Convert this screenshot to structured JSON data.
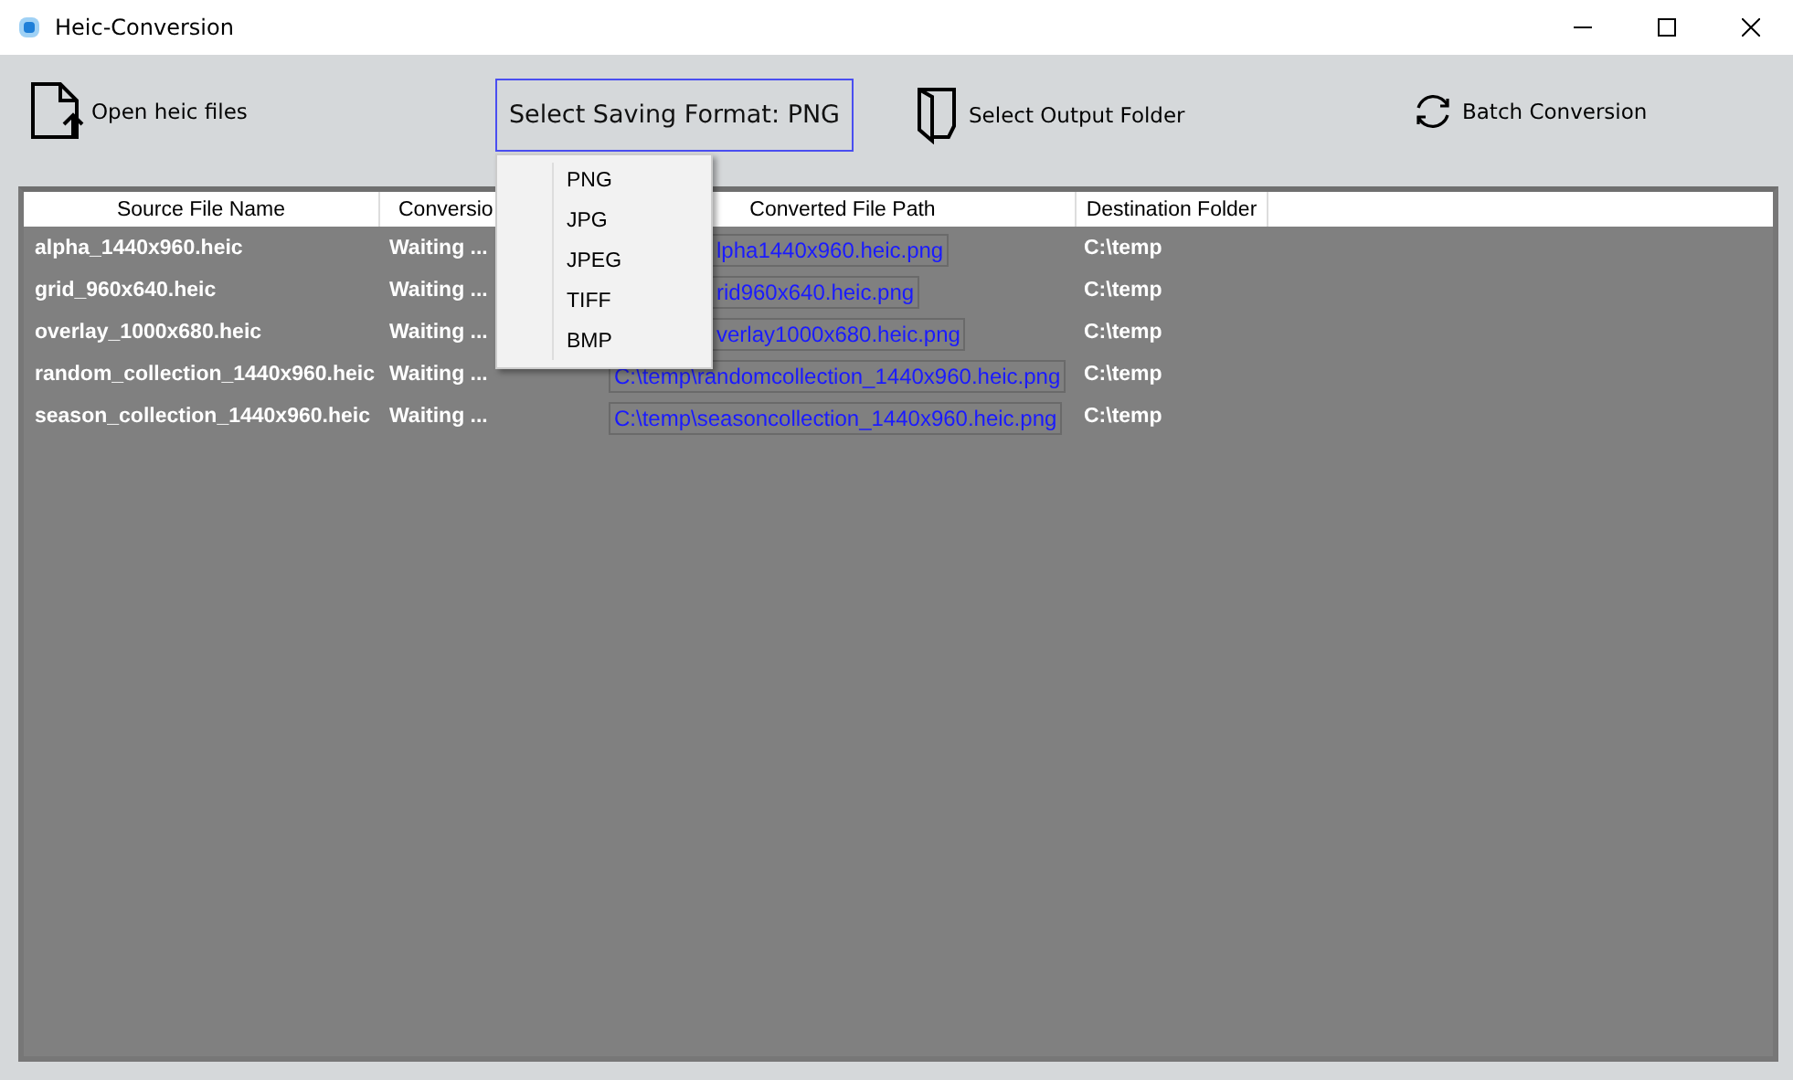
{
  "window": {
    "title": "Heic-Conversion"
  },
  "toolbar": {
    "open_button": "Open heic files",
    "format_button": "Select Saving Format: PNG",
    "output_button": "Select Output Folder",
    "batch_button": "Batch Conversion"
  },
  "format_menu": [
    {
      "label": "PNG"
    },
    {
      "label": "JPG"
    },
    {
      "label": "JPEG"
    },
    {
      "label": "TIFF"
    },
    {
      "label": "BMP"
    }
  ],
  "table": {
    "columns": [
      "Source File Name",
      "Conversio",
      "Converted File Path",
      "Destination Folder"
    ],
    "rows": [
      {
        "source": "alpha_1440x960.heic",
        "status": "Waiting ...",
        "path": "lpha1440x960.heic.png",
        "destination": "C:\\temp"
      },
      {
        "source": "grid_960x640.heic",
        "status": "Waiting ...",
        "path": "rid960x640.heic.png",
        "destination": "C:\\temp"
      },
      {
        "source": "overlay_1000x680.heic",
        "status": "Waiting ...",
        "path": "verlay1000x680.heic.png",
        "destination": "C:\\temp"
      },
      {
        "source": "random_collection_1440x960.heic",
        "status": "Waiting ...",
        "path": "C:\\temp\\randomcollection_1440x960.heic.png",
        "destination": "C:\\temp"
      },
      {
        "source": "season_collection_1440x960.heic",
        "status": "Waiting ...",
        "path": "C:\\temp\\seasoncollection_1440x960.heic.png",
        "destination": "C:\\temp"
      }
    ]
  }
}
